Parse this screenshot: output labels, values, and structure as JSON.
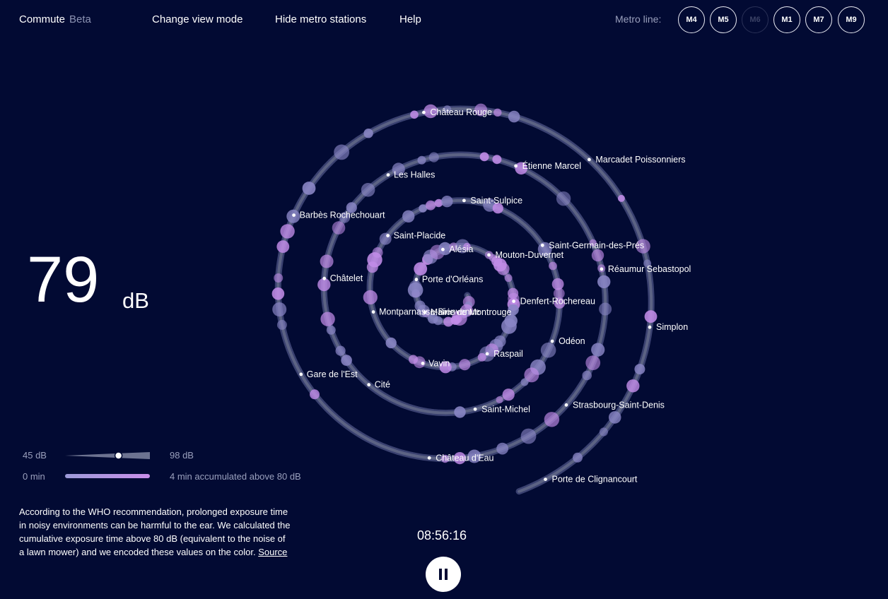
{
  "header": {
    "app_name": "Commute",
    "badge": "Beta",
    "nav": [
      "Change view mode",
      "Hide metro stations",
      "Help"
    ],
    "metro_label": "Metro line:",
    "lines": [
      {
        "label": "M4",
        "active": true
      },
      {
        "label": "M5",
        "active": true
      },
      {
        "label": "M6",
        "active": false
      },
      {
        "label": "M1",
        "active": true
      },
      {
        "label": "M7",
        "active": true
      },
      {
        "label": "M9",
        "active": true
      }
    ]
  },
  "reading": {
    "value": "79",
    "unit": "dB"
  },
  "legend": {
    "min_db": "45 dB",
    "max_db": "98 dB",
    "db_slider_fraction": 0.63,
    "min_time": "0 min",
    "accumulated": "4 min accumulated above 80 dB"
  },
  "note": {
    "text": "According to the WHO recommendation, prolonged exposure time in noisy environments can be harmful to the ear. We calculated the cumulative exposure time above 80 dB (equivalent to the noise of a lawn mower) and we encoded these values on the color.",
    "link": "Source"
  },
  "player": {
    "time": "08:56:16",
    "state": "pause"
  },
  "stations": [
    "Mairie de Montrouge",
    "Porte d'Orléans",
    "Alésia",
    "Mouton-Duvernet",
    "Denfert-Rochereau",
    "Raspail",
    "Vavin",
    "Montparnasse-Bienvenue",
    "Saint-Placide",
    "Saint-Sulpice",
    "Saint-Germain-des-Prés",
    "Odéon",
    "Saint-Michel",
    "Cité",
    "Châtelet",
    "Les Halles",
    "Étienne Marcel",
    "Réaumur Sebastopol",
    "Strasbourg-Saint-Denis",
    "Château d'Eau",
    "Gare de l'Est",
    "Barbès Rochechouart",
    "Château Rouge",
    "Marcadet Poissonniers",
    "Simplon",
    "Porte de Clignancourt"
  ],
  "colors": {
    "background": "#020a33",
    "track": "#5c6384",
    "loud": "#c28ce8",
    "quiet": "#8a86c6"
  }
}
